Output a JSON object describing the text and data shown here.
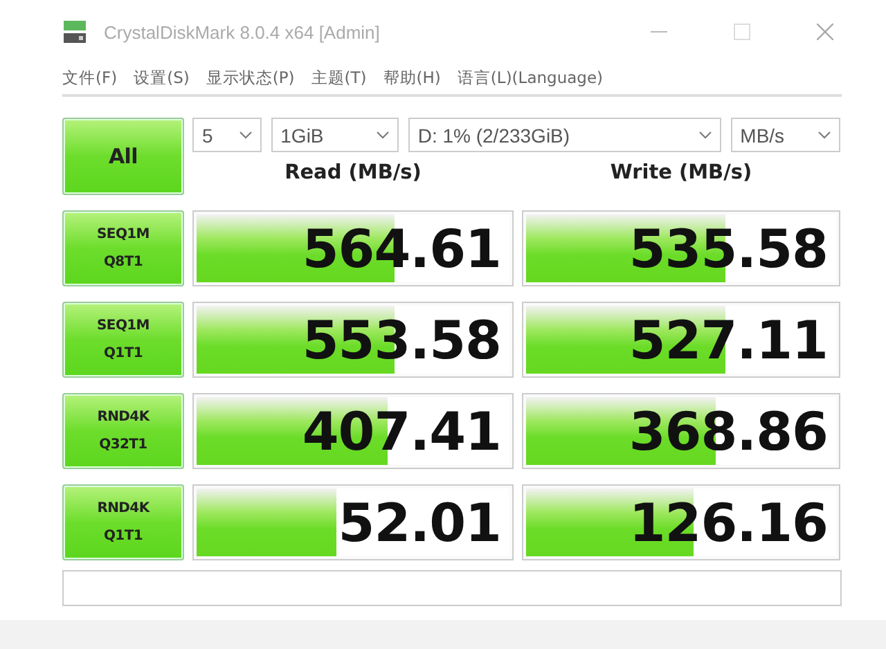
{
  "window": {
    "title": "CrystalDiskMark 8.0.4 x64 [Admin]"
  },
  "menu": [
    "文件(F)",
    "设置(S)",
    "显示状态(P)",
    "主题(T)",
    "帮助(H)",
    "语言(L)(Language)"
  ],
  "all_button": {
    "label": "All"
  },
  "selectors": [
    {
      "value": "5"
    },
    {
      "value": "1GiB"
    },
    {
      "value": "D: 1% (2/233GiB)"
    },
    {
      "value": "MB/s"
    }
  ],
  "columns": [
    "Read (MB/s)",
    "Write (MB/s)"
  ],
  "tests": [
    {
      "label": [
        "SEQ1M",
        "Q8T1"
      ],
      "read": {
        "value": "564.61",
        "level": 0.62
      },
      "write": {
        "value": "535.58",
        "level": 0.63
      }
    },
    {
      "label": [
        "SEQ1M",
        "Q1T1"
      ],
      "read": {
        "value": "553.58",
        "level": 0.62
      },
      "write": {
        "value": "527.11",
        "level": 0.63
      }
    },
    {
      "label": [
        "RND4K",
        "Q32T1"
      ],
      "read": {
        "value": "407.41",
        "level": 0.6
      },
      "write": {
        "value": "368.86",
        "level": 0.6
      }
    },
    {
      "label": [
        "RND4K",
        "Q1T1"
      ],
      "read": {
        "value": "52.01",
        "level": 0.44
      },
      "write": {
        "value": "126.16",
        "level": 0.53
      }
    }
  ]
}
